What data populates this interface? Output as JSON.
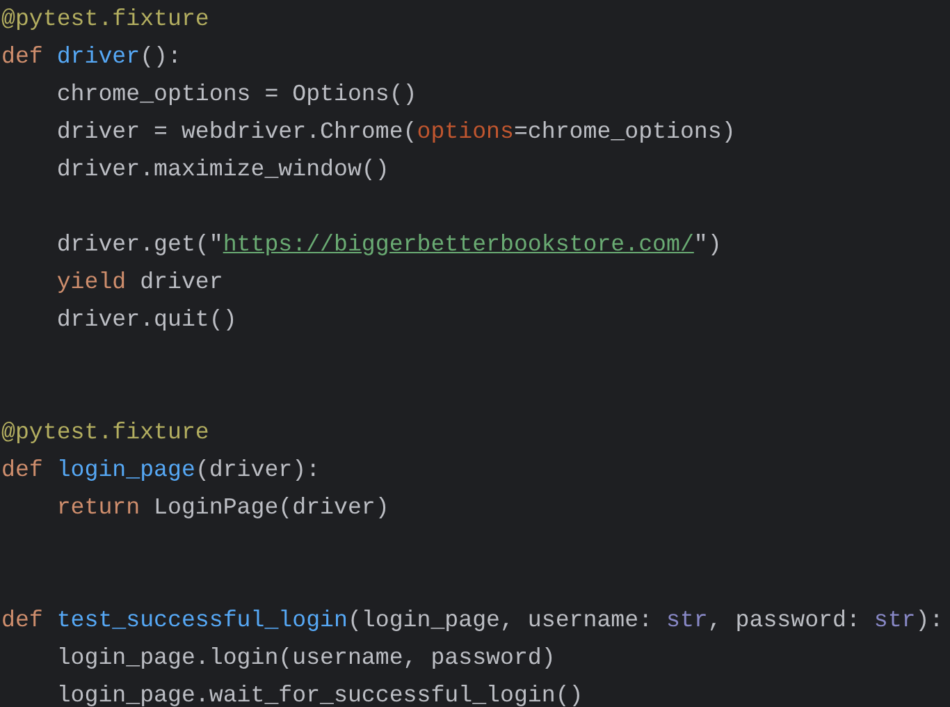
{
  "editor": {
    "lines": [
      {
        "kind": "code",
        "tokens": [
          {
            "text": "@pytest.fixture",
            "kind": "decorator"
          }
        ]
      },
      {
        "kind": "code",
        "tokens": [
          {
            "text": "def ",
            "kind": "keyword"
          },
          {
            "text": "driver",
            "kind": "function"
          },
          {
            "text": "():",
            "kind": "plain"
          }
        ]
      },
      {
        "kind": "code",
        "tokens": [
          {
            "text": "    chrome_options = Options()",
            "kind": "plain"
          }
        ]
      },
      {
        "kind": "code",
        "tokens": [
          {
            "text": "    driver = webdriver.Chrome(",
            "kind": "plain"
          },
          {
            "text": "options",
            "kind": "param"
          },
          {
            "text": "=chrome_options)",
            "kind": "plain"
          }
        ]
      },
      {
        "kind": "code",
        "tokens": [
          {
            "text": "    driver.maximize_window()",
            "kind": "plain"
          }
        ]
      },
      {
        "kind": "blank"
      },
      {
        "kind": "code",
        "tokens": [
          {
            "text": "    driver.get(\"",
            "kind": "plain"
          },
          {
            "text": "https://biggerbetterbookstore.com/",
            "kind": "link"
          },
          {
            "text": "\")",
            "kind": "plain"
          }
        ]
      },
      {
        "kind": "code",
        "tokens": [
          {
            "text": "    yield ",
            "kind": "keyword"
          },
          {
            "text": "driver",
            "kind": "plain"
          }
        ]
      },
      {
        "kind": "code",
        "tokens": [
          {
            "text": "    driver.quit()",
            "kind": "plain"
          }
        ]
      },
      {
        "kind": "blank"
      },
      {
        "kind": "blank"
      },
      {
        "kind": "code",
        "tokens": [
          {
            "text": "@pytest.fixture",
            "kind": "decorator"
          }
        ]
      },
      {
        "kind": "code",
        "tokens": [
          {
            "text": "def ",
            "kind": "keyword"
          },
          {
            "text": "login_page",
            "kind": "function"
          },
          {
            "text": "(driver):",
            "kind": "plain"
          }
        ]
      },
      {
        "kind": "code",
        "tokens": [
          {
            "text": "    return ",
            "kind": "keyword"
          },
          {
            "text": "LoginPage(driver)",
            "kind": "plain"
          }
        ]
      },
      {
        "kind": "blank"
      },
      {
        "kind": "blank"
      },
      {
        "kind": "code",
        "tokens": [
          {
            "text": "def ",
            "kind": "keyword"
          },
          {
            "text": "test_successful_login",
            "kind": "function"
          },
          {
            "text": "(login_page, username: ",
            "kind": "plain"
          },
          {
            "text": "str",
            "kind": "builtin"
          },
          {
            "text": ", password: ",
            "kind": "plain"
          },
          {
            "text": "str",
            "kind": "builtin"
          },
          {
            "text": "):",
            "kind": "plain"
          }
        ]
      },
      {
        "kind": "code",
        "tokens": [
          {
            "text": "    login_page.login(username, password)",
            "kind": "plain"
          }
        ]
      },
      {
        "kind": "code",
        "tokens": [
          {
            "text": "    login_page.wait_for_successful_login()",
            "kind": "plain"
          }
        ]
      }
    ]
  }
}
